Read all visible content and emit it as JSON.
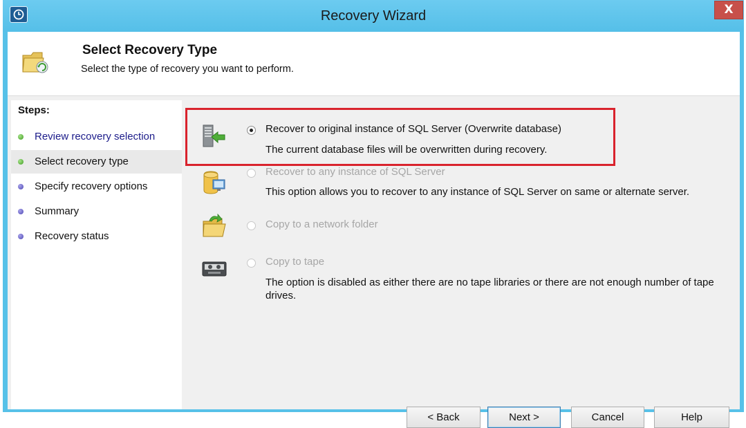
{
  "window": {
    "title": "Recovery Wizard",
    "close_label": "X"
  },
  "header": {
    "title": "Select Recovery Type",
    "subtitle": "Select the type of recovery you want to perform."
  },
  "steps": {
    "heading": "Steps:",
    "items": [
      {
        "label": "Review recovery selection",
        "state": "completed-link"
      },
      {
        "label": "Select recovery type",
        "state": "current"
      },
      {
        "label": "Specify recovery options",
        "state": "pending"
      },
      {
        "label": "Summary",
        "state": "pending"
      },
      {
        "label": "Recovery status",
        "state": "pending"
      }
    ]
  },
  "options": [
    {
      "icon": "server-restore-icon",
      "label": "Recover to original instance of SQL Server (Overwrite database)",
      "description": "The current database files will be overwritten during recovery.",
      "selected": true,
      "enabled": true
    },
    {
      "icon": "database-server-icon",
      "label": "Recover to any instance of SQL Server",
      "description": "This option allows you to recover to any instance of SQL Server on same or alternate server.",
      "selected": false,
      "enabled": false
    },
    {
      "icon": "network-folder-icon",
      "label": "Copy to a network folder",
      "description": "",
      "selected": false,
      "enabled": false
    },
    {
      "icon": "tape-icon",
      "label": "Copy to tape",
      "description": "The option is disabled as either there are no tape libraries or there are not enough number of tape drives.",
      "selected": false,
      "enabled": false
    }
  ],
  "buttons": {
    "back": "< Back",
    "next": "Next >",
    "cancel": "Cancel",
    "help": "Help"
  },
  "colors": {
    "titlebar": "#57c1e8",
    "close": "#c7504a",
    "highlight_box": "#d9232d",
    "step_link": "#1c1c8a",
    "step_done_dot": "#3f9c21",
    "step_pending_dot": "#4d46b3"
  }
}
